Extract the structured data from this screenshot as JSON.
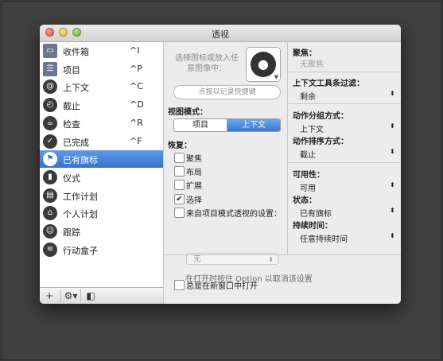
{
  "window": {
    "title": "透视"
  },
  "sidebar": {
    "items": [
      {
        "label": "收件箱",
        "shortcut": "^I",
        "icon": "inbox-icon",
        "glyph": "▭",
        "selected": false
      },
      {
        "label": "项目",
        "shortcut": "^P",
        "icon": "projects-icon",
        "glyph": "☰",
        "selected": false
      },
      {
        "label": "上下文",
        "shortcut": "^C",
        "icon": "contexts-icon",
        "glyph": "@",
        "selected": false
      },
      {
        "label": "截止",
        "shortcut": "^D",
        "icon": "due-icon",
        "glyph": "◴",
        "selected": false
      },
      {
        "label": "检查",
        "shortcut": "^R",
        "icon": "review-icon",
        "glyph": "☕",
        "selected": false
      },
      {
        "label": "已完成",
        "shortcut": "^F",
        "icon": "completed-icon",
        "glyph": "✓",
        "selected": false
      },
      {
        "label": "已有旗标",
        "shortcut": "",
        "icon": "flagged-icon",
        "glyph": "⚑",
        "selected": true
      },
      {
        "label": "仪式",
        "shortcut": "",
        "icon": "chart-icon",
        "glyph": "▮",
        "selected": false
      },
      {
        "label": "工作计划",
        "shortcut": "",
        "icon": "briefcase-icon",
        "glyph": "▤",
        "selected": false
      },
      {
        "label": "个人计划",
        "shortcut": "",
        "icon": "home-icon",
        "glyph": "⌂",
        "selected": false
      },
      {
        "label": "跟踪",
        "shortcut": "",
        "icon": "people-icon",
        "glyph": "☺",
        "selected": false
      },
      {
        "label": "行动盒子",
        "shortcut": "",
        "icon": "stack-icon",
        "glyph": "≡",
        "selected": false
      }
    ],
    "bottom": {
      "add": "+",
      "gear": "⚙▾",
      "toggle": "◧"
    }
  },
  "middle": {
    "image_hint": "选择图标或放入任意图像中：",
    "shortcut_placeholder": "点按以记录快捷键",
    "view_mode_label": "视图模式：",
    "view_modes": [
      "项目",
      "上下文"
    ],
    "view_mode_selected": "上下文",
    "restore_label": "恢复：",
    "restore_options": [
      {
        "label": "聚焦",
        "checked": false
      },
      {
        "label": "布局",
        "checked": false
      },
      {
        "label": "扩展",
        "checked": false
      },
      {
        "label": "选择",
        "checked": true
      },
      {
        "label": "来自项目模式透视的设置：",
        "checked": false
      }
    ],
    "project_settings_value": "无",
    "new_window_label": "总是在新窗口中打开",
    "new_window_checked": false,
    "option_hint": "在打开时按住 Option 以取消该设置"
  },
  "right": {
    "focus_label": "聚焦：",
    "focus_value": "无聚焦",
    "toolbar_filter_label": "上下文工具条过滤：",
    "toolbar_filter_value": "剩余",
    "grouping_label": "动作分组方式：",
    "grouping_value": "上下文",
    "sorting_label": "动作排序方式：",
    "sorting_value": "截止",
    "availability_label": "可用性：",
    "availability_value": "可用",
    "status_label": "状态：",
    "status_value": "已有旗标",
    "duration_label": "持续时间：",
    "duration_value": "任意持续时间"
  }
}
